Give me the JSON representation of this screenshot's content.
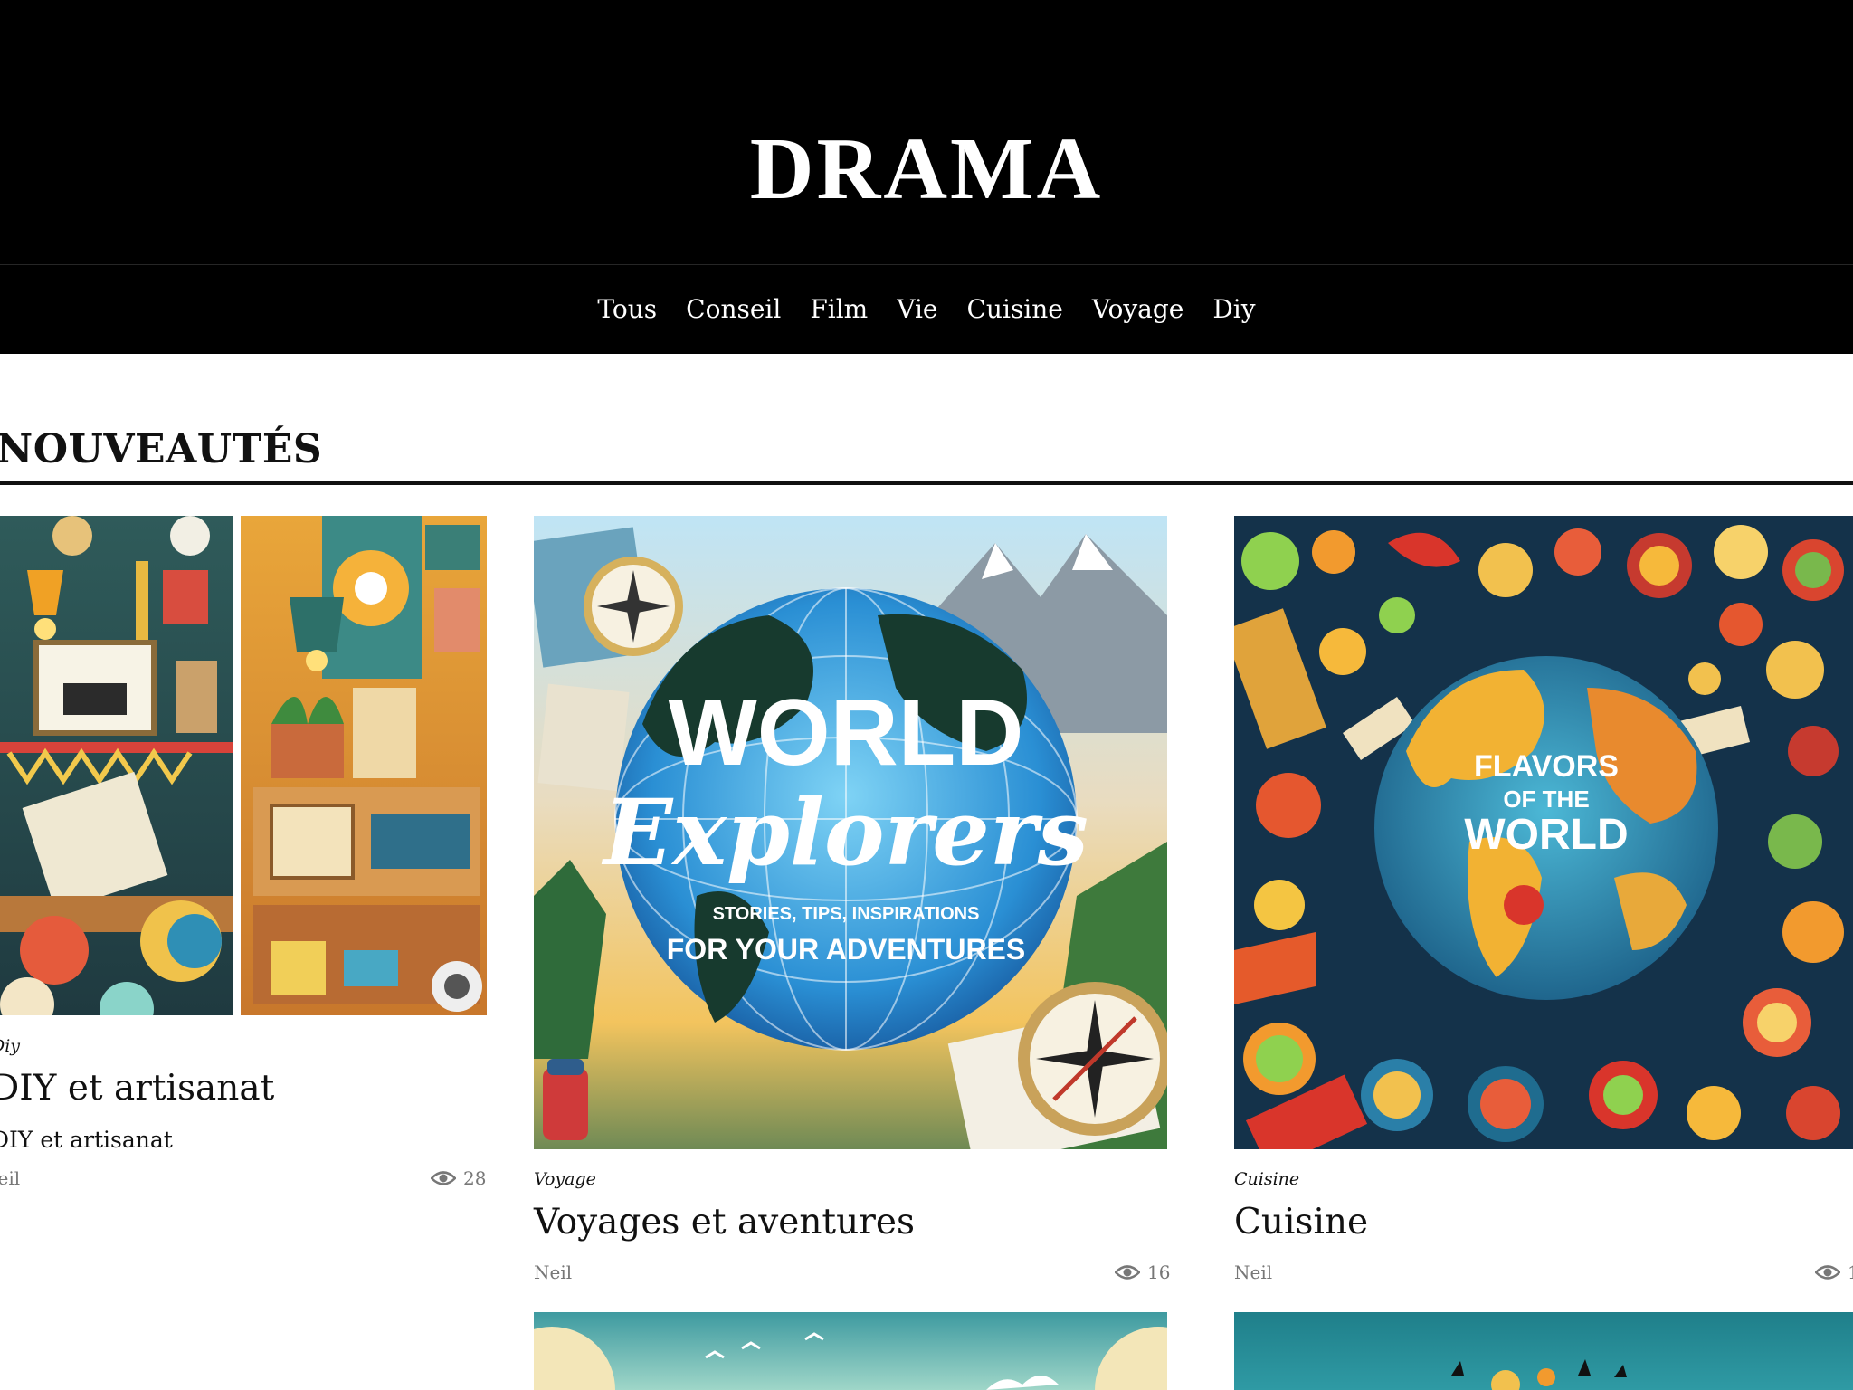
{
  "site": {
    "title": "DRAMA"
  },
  "nav": {
    "items": [
      "Tous",
      "Conseil",
      "Film",
      "Vie",
      "Cuisine",
      "Voyage",
      "Diy"
    ]
  },
  "section": {
    "title": "NOUVEAUTÉS"
  },
  "posts": [
    {
      "category": "Diy",
      "title": "DIY et artisanat",
      "excerpt": "DIY et artisanat",
      "author": "Neil",
      "views": "28",
      "image_icon": "craft-workshop-image"
    },
    {
      "category": "Voyage",
      "title": "Voyages et aventures",
      "author": "Neil",
      "views": "16",
      "image_icon": "world-explorers-image",
      "image_text": {
        "line1": "WORLD",
        "line2": "Explorers",
        "line3": "STORIES, TIPS, INSPIRATIONS",
        "line4": "FOR YOUR ADVENTURES"
      }
    },
    {
      "category": "Cuisine",
      "title": "Cuisine",
      "author": "Neil",
      "views": "1",
      "image_icon": "flavors-of-the-world-image",
      "image_text": {
        "line1": "FLAVORS",
        "line2": "OF THE",
        "line3": "WORLD"
      }
    }
  ],
  "colors": {
    "header_bg": "#000000",
    "header_text": "#ffffff",
    "muted_text": "#777777"
  }
}
